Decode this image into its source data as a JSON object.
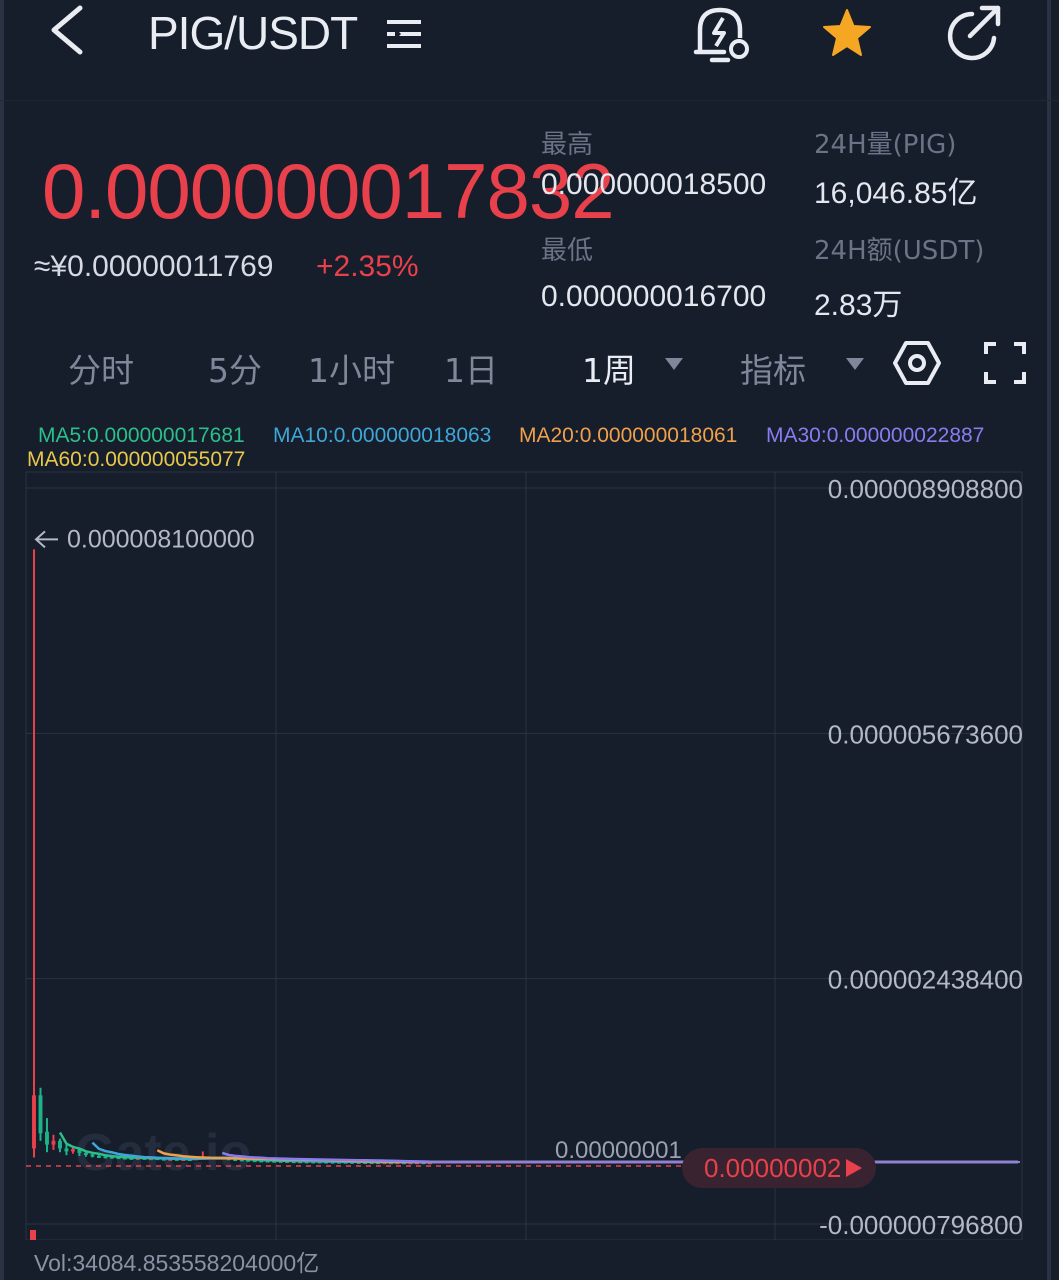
{
  "header": {
    "pair": "PIG/USDT",
    "icons": [
      "back-arrow-icon",
      "list-menu-icon",
      "price-alert-bell-icon",
      "star-icon",
      "share-icon"
    ]
  },
  "price": {
    "last": "0.000000017832",
    "cny": "≈¥0.00000011769",
    "change": "+2.35%"
  },
  "stats": {
    "high_label": "最高",
    "high_value": "0.000000018500",
    "low_label": "最低",
    "low_value": "0.000000016700",
    "vol_label": "24H量(PIG)",
    "vol_value": "16,046.85亿",
    "amount_label": "24H额(USDT)",
    "amount_value": "2.83万"
  },
  "tabs": {
    "timeshare": "分时",
    "m5": "5分",
    "h1": "1小时",
    "d1": "1日",
    "w1": "1周",
    "indicator": "指标",
    "selected": "1周"
  },
  "ma": {
    "ma5": "MA5:0.000000017681",
    "ma10": "MA10:0.000000018063",
    "ma20": "MA20:0.000000018061",
    "ma30": "MA30:0.000000022887",
    "ma60": "MA60:0.000000055077"
  },
  "colors": {
    "up": "#e8414b",
    "down": "#1db388",
    "ma5": "#2bbf8a",
    "ma10": "#3ea7d8",
    "ma20": "#f0a04b",
    "ma30": "#8a7cf0",
    "ma60": "#e8c84a",
    "background": "#161d2b",
    "grid": "#2a3344"
  },
  "chart_data": {
    "type": "candlestick",
    "y_axis_labels": [
      "0.000008908800",
      "0.000005673600",
      "0.000002438400",
      "-0.000000796800"
    ],
    "ylim": [
      -7.968e-07,
      8.9088e-06
    ],
    "max_marker": "0.000008100000",
    "max_value": 8.1e-06,
    "current_price_tag": "0.00000002",
    "current_price": 2e-08,
    "partial_axis_label": "0.00000001",
    "watermark": "Gate.io",
    "candles": [
      {
        "open": 2e-07,
        "close": 9e-07,
        "high": 8.1e-06,
        "low": 8e-08
      },
      {
        "open": 9e-07,
        "close": 4e-07,
        "high": 1e-06,
        "low": 3e-07
      },
      {
        "open": 4.2e-07,
        "close": 2.5e-07,
        "high": 6e-07,
        "low": 1.5e-07
      },
      {
        "open": 2.5e-07,
        "close": 3e-07,
        "high": 3.8e-07,
        "low": 1.8e-07
      },
      {
        "open": 3e-07,
        "close": 2e-07,
        "high": 3.3e-07,
        "low": 1.5e-07
      },
      {
        "open": 2e-07,
        "close": 1.6e-07,
        "high": 2.5e-07,
        "low": 1.1e-07
      },
      {
        "open": 1.6e-07,
        "close": 1.9e-07,
        "high": 2.2e-07,
        "low": 1.3e-07
      },
      {
        "open": 1.9e-07,
        "close": 1.4e-07,
        "high": 2e-07,
        "low": 1e-07
      },
      {
        "open": 1.4e-07,
        "close": 1.2e-07,
        "high": 1.6e-07,
        "low": 9e-08
      },
      {
        "open": 1.2e-07,
        "close": 1e-07,
        "high": 1.3e-07,
        "low": 8e-08
      },
      {
        "open": 1e-07,
        "close": 9.5e-08,
        "high": 1.2e-07,
        "low": 8e-08
      },
      {
        "open": 9.5e-08,
        "close": 9e-08,
        "high": 1.1e-07,
        "low": 7e-08
      },
      {
        "open": 9e-08,
        "close": 8.5e-08,
        "high": 1e-07,
        "low": 7e-08
      },
      {
        "open": 8.5e-08,
        "close": 8e-08,
        "high": 9.5e-08,
        "low": 6.5e-08
      },
      {
        "open": 8e-08,
        "close": 7.5e-08,
        "high": 9e-08,
        "low": 6e-08
      },
      {
        "open": 7.5e-08,
        "close": 7e-08,
        "high": 8.5e-08,
        "low": 5.5e-08
      },
      {
        "open": 7e-08,
        "close": 7.5e-08,
        "high": 8.5e-08,
        "low": 6e-08
      },
      {
        "open": 7.5e-08,
        "close": 6.8e-08,
        "high": 8e-08,
        "low": 5.5e-08
      },
      {
        "open": 6.8e-08,
        "close": 7.2e-08,
        "high": 8e-08,
        "low": 5.8e-08
      },
      {
        "open": 7.2e-08,
        "close": 6.5e-08,
        "high": 7.8e-08,
        "low": 5e-08
      },
      {
        "open": 6.5e-08,
        "close": 6e-08,
        "high": 7e-08,
        "low": 4.8e-08
      },
      {
        "open": 6e-08,
        "close": 6.2e-08,
        "high": 7e-08,
        "low": 5e-08
      },
      {
        "open": 6.2e-08,
        "close": 5.8e-08,
        "high": 6.8e-08,
        "low": 4.5e-08
      },
      {
        "open": 5.8e-08,
        "close": 6e-08,
        "high": 6.6e-08,
        "low": 4.8e-08
      },
      {
        "open": 6e-08,
        "close": 5.6e-08,
        "high": 6.4e-08,
        "low": 4.5e-08
      },
      {
        "open": 5.6e-08,
        "close": 7e-08,
        "high": 8e-08,
        "low": 5e-08
      },
      {
        "open": 7e-08,
        "close": 9e-08,
        "high": 1.6e-07,
        "low": 6e-08
      },
      {
        "open": 9e-08,
        "close": 7.5e-08,
        "high": 9.5e-08,
        "low": 6e-08
      },
      {
        "open": 7.5e-08,
        "close": 8e-08,
        "high": 9e-08,
        "low": 6e-08
      },
      {
        "open": 8e-08,
        "close": 7e-08,
        "high": 8.5e-08,
        "low": 5.5e-08
      },
      {
        "open": 7e-08,
        "close": 6e-08,
        "high": 7.5e-08,
        "low": 5e-08
      },
      {
        "open": 6e-08,
        "close": 5.5e-08,
        "high": 6.5e-08,
        "low": 4.5e-08
      },
      {
        "open": 5.5e-08,
        "close": 5e-08,
        "high": 6e-08,
        "low": 4e-08
      },
      {
        "open": 5e-08,
        "close": 4.5e-08,
        "high": 5.5e-08,
        "low": 3.8e-08
      },
      {
        "open": 4.5e-08,
        "close": 4.2e-08,
        "high": 5e-08,
        "low": 3.6e-08
      },
      {
        "open": 4.2e-08,
        "close": 4e-08,
        "high": 4.6e-08,
        "low": 3.4e-08
      },
      {
        "open": 4e-08,
        "close": 3.8e-08,
        "high": 4.4e-08,
        "low": 3.2e-08
      },
      {
        "open": 3.8e-08,
        "close": 3.6e-08,
        "high": 4.2e-08,
        "low": 3e-08
      },
      {
        "open": 3.6e-08,
        "close": 3.4e-08,
        "high": 4e-08,
        "low": 2.9e-08
      },
      {
        "open": 3.4e-08,
        "close": 3.2e-08,
        "high": 3.8e-08,
        "low": 2.8e-08
      },
      {
        "open": 3.2e-08,
        "close": 3.1e-08,
        "high": 3.6e-08,
        "low": 2.7e-08
      },
      {
        "open": 3.1e-08,
        "close": 3e-08,
        "high": 3.4e-08,
        "low": 2.6e-08
      },
      {
        "open": 3e-08,
        "close": 2.9e-08,
        "high": 3.3e-08,
        "low": 2.5e-08
      },
      {
        "open": 2.9e-08,
        "close": 2.8e-08,
        "high": 3.2e-08,
        "low": 2.4e-08
      },
      {
        "open": 2.8e-08,
        "close": 2.7e-08,
        "high": 3.1e-08,
        "low": 2.3e-08
      },
      {
        "open": 2.7e-08,
        "close": 2.6e-08,
        "high": 3e-08,
        "low": 2.2e-08
      },
      {
        "open": 2.6e-08,
        "close": 2.5e-08,
        "high": 2.9e-08,
        "low": 2.1e-08
      },
      {
        "open": 2.5e-08,
        "close": 2.4e-08,
        "high": 2.8e-08,
        "low": 2e-08
      },
      {
        "open": 2.4e-08,
        "close": 2.3e-08,
        "high": 2.7e-08,
        "low": 2e-08
      },
      {
        "open": 2.3e-08,
        "close": 2.2e-08,
        "high": 2.6e-08,
        "low": 1.9e-08
      },
      {
        "open": 2.2e-08,
        "close": 2.1e-08,
        "high": 2.5e-08,
        "low": 1.9e-08
      },
      {
        "open": 2.1e-08,
        "close": 2e-08,
        "high": 2.4e-08,
        "low": 1.8e-08
      },
      {
        "open": 2e-08,
        "close": 1.9e-08,
        "high": 2.3e-08,
        "low": 1.8e-08
      },
      {
        "open": 1.9e-08,
        "close": 1.8e-08,
        "high": 2.2e-08,
        "low": 1.7e-08
      },
      {
        "open": 1.8e-08,
        "close": 1.8e-08,
        "high": 2.1e-08,
        "low": 1.7e-08
      },
      {
        "open": 1.8e-08,
        "close": 1.7e-08,
        "high": 2e-08,
        "low": 1.6e-08
      },
      {
        "open": 1.7e-08,
        "close": 1.8e-08,
        "high": 2e-08,
        "low": 1.6e-08
      },
      {
        "open": 1.8e-08,
        "close": 1.7e-08,
        "high": 1.9e-08,
        "low": 1.6e-08
      },
      {
        "open": 1.7e-08,
        "close": 1.7e-08,
        "high": 1.9e-08,
        "low": 1.6e-08
      },
      {
        "open": 1.7e-08,
        "close": 1.8e-08,
        "high": 1.9e-08,
        "low": 1.6e-08
      },
      {
        "open": 1.8e-08,
        "close": 1.7e-08,
        "high": 1.9e-08,
        "low": 1.6e-08
      },
      {
        "open": 1.7e-08,
        "close": 1.8e-08,
        "high": 1.9e-08,
        "low": 1.6e-08
      }
    ],
    "volume_label": "Vol:34084.853558204000亿"
  }
}
